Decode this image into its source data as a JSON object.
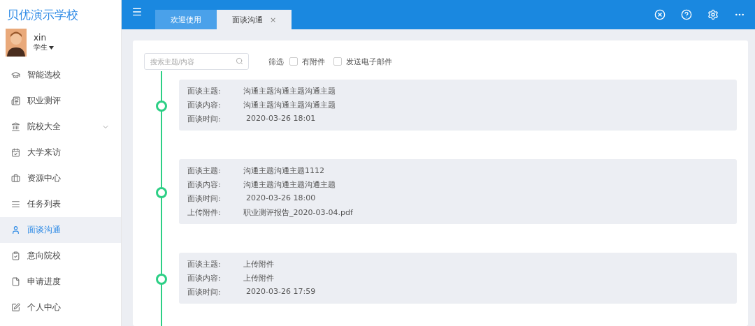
{
  "sidebar": {
    "logo": "贝优演示学校",
    "user": {
      "name": "xin",
      "role": "学生"
    },
    "items": [
      {
        "label": "智能选校",
        "selected": false
      },
      {
        "label": "职业测评",
        "selected": false
      },
      {
        "label": "院校大全",
        "selected": false,
        "expanded": false
      },
      {
        "label": "大学来访",
        "selected": false
      },
      {
        "label": "资源中心",
        "selected": false
      },
      {
        "label": "任务列表",
        "selected": false
      },
      {
        "label": "面谈沟通",
        "selected": true
      },
      {
        "label": "意向院校",
        "selected": false
      },
      {
        "label": "申请进度",
        "selected": false
      },
      {
        "label": "个人中心",
        "selected": false
      }
    ]
  },
  "tabs": [
    {
      "label": "欢迎使用",
      "selected": false
    },
    {
      "label": "面谈沟通",
      "selected": true,
      "close": "×"
    }
  ],
  "filter": {
    "search": {
      "placeholder": "搜索主题/内容"
    },
    "label": "筛选",
    "options": [
      {
        "label": "有附件",
        "checked": false
      },
      {
        "label": "发送电子邮件",
        "checked": false
      }
    ]
  },
  "timeline": [
    {
      "fields": [
        {
          "label": "面谈主题:",
          "value": "沟通主题沟通主题沟通主题"
        },
        {
          "label": "面谈内容:",
          "value": "沟通主题沟通主题沟通主题"
        },
        {
          "label": "面谈时间:",
          "value": "2020-03-26 18:01"
        }
      ]
    },
    {
      "fields": [
        {
          "label": "面谈主题:",
          "value": "沟通主题沟通主题1112"
        },
        {
          "label": "面谈内容:",
          "value": "沟通主题沟通主题沟通主题"
        },
        {
          "label": "面谈时间:",
          "value": "2020-03-26 18:00"
        },
        {
          "label": "上传附件:",
          "value": "职业测评报告_2020-03-04.pdf"
        }
      ]
    },
    {
      "fields": [
        {
          "label": "面谈主题:",
          "value": "上传附件"
        },
        {
          "label": "面谈内容:",
          "value": "上传附件"
        },
        {
          "label": "面谈时间:",
          "value": "2020-03-26 17:59"
        }
      ]
    }
  ]
}
